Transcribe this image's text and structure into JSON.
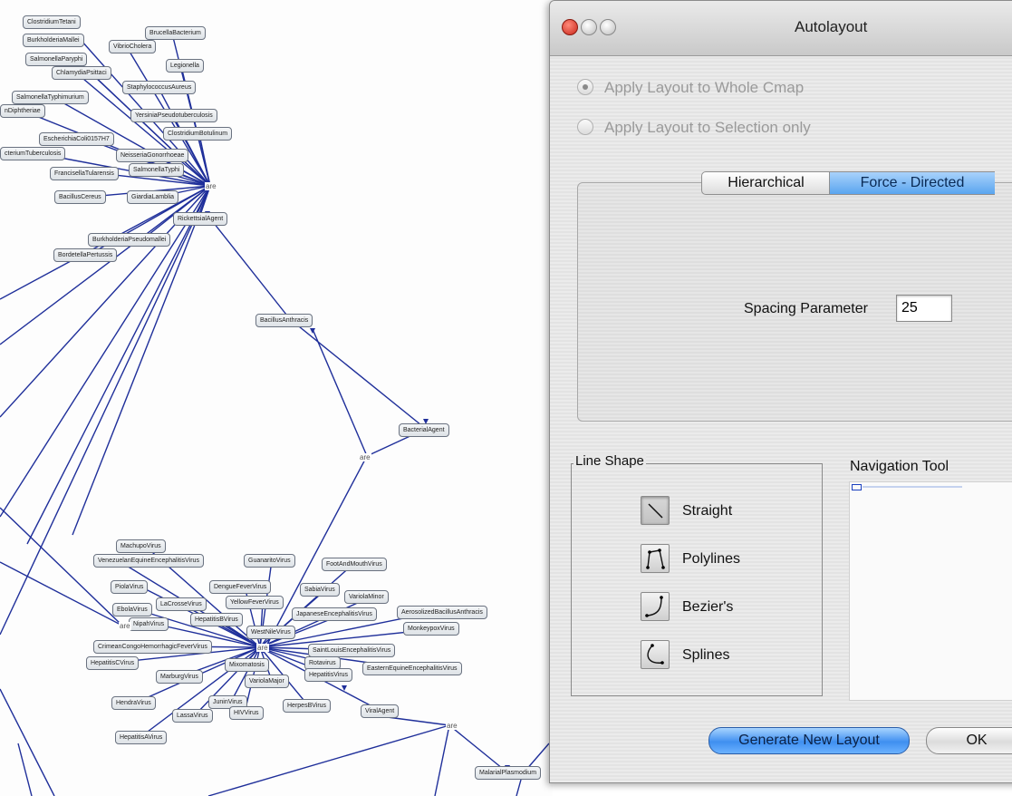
{
  "dialog": {
    "title": "Autolayout",
    "radio_whole": "Apply Layout to Whole Cmap",
    "radio_selection": "Apply Layout to Selection only",
    "tabs": [
      "Hierarchical",
      "Force - Directed"
    ],
    "selected_tab": "Force - Directed",
    "spacing_label": "Spacing Parameter",
    "spacing_value": "25",
    "line_shape_title": "Line Shape",
    "line_shapes": [
      "Straight",
      "Polylines",
      "Bezier's",
      "Splines"
    ],
    "selected_line_shape": "Straight",
    "nav_title": "Navigation Tool",
    "generate_label": "Generate New Layout",
    "ok_label": "OK"
  },
  "map": {
    "link_label": "are",
    "nodes": {
      "n1": "ClostridiumTetani",
      "n2": "BurkholderiaMallei",
      "n3": "BrucellaBacterium",
      "n4": "VibrioCholera",
      "n5": "SalmonellaParyphi",
      "n6": "ChlamydiaPsittaci",
      "n7": "Legionella",
      "n8": "StaphylococcusAureus",
      "n9": "SalmonellaTyphimurium",
      "n10": "nDiphtheriae",
      "n11": "YersiniaPseudotuberculosis",
      "n12": "ClostridiumBotulinum",
      "n13": "EscherichiaColi0157H7",
      "n14": "cteriumTuberculosis",
      "n15": "NeisseriaGonorrhoeae",
      "n16": "FrancisellaTularensis",
      "n17": "SalmonellaTyphi",
      "n18": "BacillusCereus",
      "n19": "GiardiaLamblia",
      "n20": "RickettsialAgent",
      "n21": "BurkholderiaPseudomallei",
      "n22": "BordetellaPertussis",
      "n23": "BacillusAnthracis",
      "n24": "BacterialAgent",
      "n25": "MachupoVirus",
      "n26": "VenezuelanEquineEncephalitisVirus",
      "n27": "GuanaritoVirus",
      "n28": "FootAndMouthVirus",
      "n29": "PiolaVirus",
      "n30": "DengueFeverVirus",
      "n31": "SabiaVirus",
      "n32": "VariolaMinor",
      "n33": "EbolaVirus",
      "n34": "LaCrosseVirus",
      "n35": "YellowFeverVirus",
      "n36": "JapaneseEncephalitisVirus",
      "n37": "AerosolizedBacillusAnthracis",
      "n38": "NipahVirus",
      "n39": "HepatitisBVirus",
      "n40": "MonkeypoxVirus",
      "n41": "WestNileVirus",
      "n42": "CrimeanCongoHemorrhagicFeverVirus",
      "n43": "SaintLouisEncephalitisVirus",
      "n44": "HepatitisCVirus",
      "n45": "Mixomatosis",
      "n46": "Rotavirus",
      "n47": "EasternEquineEncephalitisVirus",
      "n48": "MarburgVirus",
      "n49": "VariolaMajor",
      "n50": "HepatitisVirus",
      "n51": "HendraVirus",
      "n52": "JuninVirus",
      "n53": "HerpesBVirus",
      "n54": "ViralAgent",
      "n55": "LassaVirus",
      "n56": "HIVVirus",
      "n57": "HepatitisAVirus",
      "n58": "MalarialPlasmodium"
    }
  }
}
